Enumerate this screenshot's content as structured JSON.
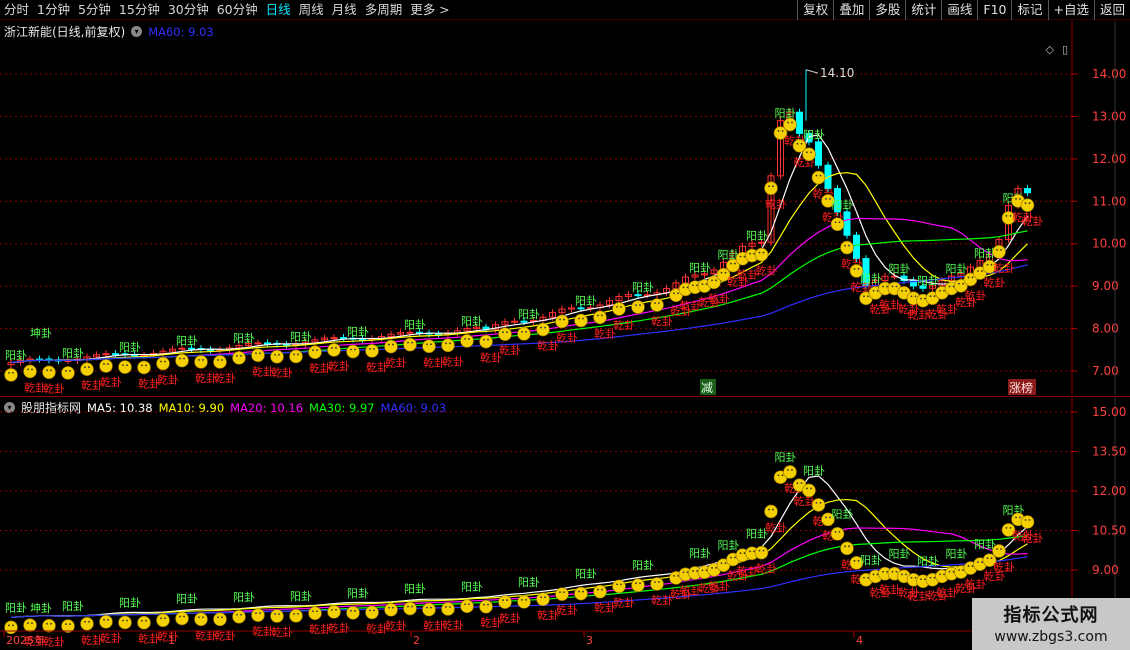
{
  "toolbar": {
    "periods": [
      "分时",
      "1分钟",
      "5分钟",
      "15分钟",
      "30分钟",
      "60分钟",
      "日线",
      "周线",
      "月线",
      "多周期",
      "更多"
    ],
    "active_period": "日线",
    "right_buttons": [
      "复权",
      "叠加",
      "多股",
      "统计",
      "画线",
      "F10",
      "标记",
      "+自选",
      "返回"
    ]
  },
  "main_pane": {
    "title": "浙江新能(日线,前复权)",
    "ma_label": "MA60: 9.03",
    "price_axis": [
      "14.00",
      "13.00",
      "12.00",
      "11.00",
      "10.00",
      "9.00",
      "8.00",
      "7.00"
    ],
    "peak_label": "14.10",
    "marker_jian": "减",
    "marker_zhangbang": "涨榜"
  },
  "sub_pane": {
    "title": "股朋指标网",
    "ma": [
      {
        "label": "MA5: 10.38",
        "color": "#ffffff"
      },
      {
        "label": "MA10: 9.90",
        "color": "#ffff00"
      },
      {
        "label": "MA20: 10.16",
        "color": "#ff00ff"
      },
      {
        "label": "MA30: 9.97",
        "color": "#00ff00"
      },
      {
        "label": "MA60: 9.03",
        "color": "#3030ff"
      }
    ],
    "price_axis": [
      "15.00",
      "13.50",
      "12.00",
      "10.50",
      "9.00"
    ]
  },
  "date_axis": [
    "2025年",
    "1",
    "2",
    "3",
    "4"
  ],
  "signal_labels": {
    "yang": "阳卦",
    "yin": "阴卦",
    "qian": "乾卦",
    "kun": "坤卦"
  },
  "watermark": {
    "line1": "指标公式网",
    "line2": "www.zbgs3.com"
  },
  "colors": {
    "up": "#ff3030",
    "down": "#00ffff",
    "grid": "#8b0000",
    "ma5": "#ffffff",
    "ma10": "#ffff00",
    "ma20": "#ff00ff",
    "ma30": "#00ff00",
    "ma60": "#3030ff",
    "emoji": "#f5d000"
  }
}
